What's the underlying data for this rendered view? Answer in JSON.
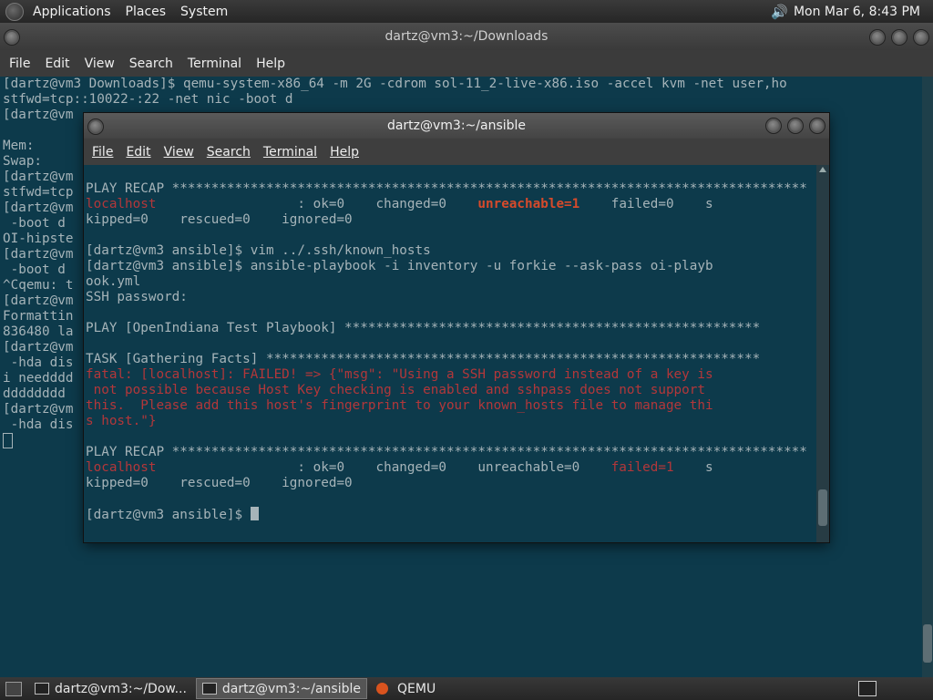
{
  "top_panel": {
    "menus": [
      "Applications",
      "Places",
      "System"
    ],
    "clock": "Mon Mar  6,  8:43 PM"
  },
  "back_window": {
    "title": "dartz@vm3:~/Downloads",
    "menu": [
      "File",
      "Edit",
      "View",
      "Search",
      "Terminal",
      "Help"
    ],
    "lines": [
      "[dartz@vm3 Downloads]$ qemu-system-x86_64 -m 2G -cdrom sol-11_2-live-x86.iso -accel kvm -net user,ho",
      "stfwd=tcp::10022-:22 -net nic -boot d",
      "[dartz@vm",
      "",
      "Mem:",
      "Swap:",
      "[dartz@vm                                                                                 t user,ho",
      "stfwd=tcp",
      "[dartz@vm                                                                                 -net nic",
      " -boot d",
      "OI-hipste",
      "[dartz@vm                                                                                 -net nic",
      " -boot d",
      "^Cqemu: t",
      "[dartz@vm",
      "Formattin                                                                                ize=21474",
      "836480 la",
      "[dartz@vm                                                                                 -net nic",
      " -hda dis",
      "i needddd                                                                               dddddddd",
      "dddddddd",
      "[dartz@vm                                                                                 -net nic",
      " -hda dis"
    ]
  },
  "front_window": {
    "title": "dartz@vm3:~/ansible",
    "menu": [
      "File",
      "Edit",
      "View",
      "Search",
      "Terminal",
      "Help"
    ],
    "lines": [
      {
        "segs": [
          {
            "t": "PLAY RECAP *********************************************************************************"
          }
        ]
      },
      {
        "segs": [
          {
            "t": "localhost",
            "c": "red"
          },
          {
            "t": "                  : ok=0    changed=0    "
          },
          {
            "t": "unreachable=1",
            "c": "bold-red"
          },
          {
            "t": "    failed=0    s"
          }
        ]
      },
      {
        "segs": [
          {
            "t": "kipped=0    rescued=0    ignored=0"
          }
        ]
      },
      {
        "segs": [
          {
            "t": ""
          }
        ]
      },
      {
        "segs": [
          {
            "t": "[dartz@vm3 ansible]$ vim ../.ssh/known_hosts"
          }
        ]
      },
      {
        "segs": [
          {
            "t": "[dartz@vm3 ansible]$ ansible-playbook -i inventory -u forkie --ask-pass oi-playb"
          }
        ]
      },
      {
        "segs": [
          {
            "t": "ook.yml"
          }
        ]
      },
      {
        "segs": [
          {
            "t": "SSH password:"
          }
        ]
      },
      {
        "segs": [
          {
            "t": ""
          }
        ]
      },
      {
        "segs": [
          {
            "t": "PLAY [OpenIndiana Test Playbook] *****************************************************"
          }
        ]
      },
      {
        "segs": [
          {
            "t": ""
          }
        ]
      },
      {
        "segs": [
          {
            "t": "TASK [Gathering Facts] ***************************************************************"
          }
        ]
      },
      {
        "segs": [
          {
            "t": "fatal: [localhost]: FAILED! => {\"msg\": \"Using a SSH password instead of a key is",
            "c": "red"
          }
        ]
      },
      {
        "segs": [
          {
            "t": " not possible because Host Key checking is enabled and sshpass does not support",
            "c": "red"
          }
        ]
      },
      {
        "segs": [
          {
            "t": "this.  Please add this host's fingerprint to your known_hosts file to manage thi",
            "c": "red"
          }
        ]
      },
      {
        "segs": [
          {
            "t": "s host.\"}",
            "c": "red"
          }
        ]
      },
      {
        "segs": [
          {
            "t": ""
          }
        ]
      },
      {
        "segs": [
          {
            "t": "PLAY RECAP *********************************************************************************"
          }
        ]
      },
      {
        "segs": [
          {
            "t": "localhost",
            "c": "red"
          },
          {
            "t": "                  : ok=0    changed=0    unreachable=0    "
          },
          {
            "t": "failed=1",
            "c": "red"
          },
          {
            "t": "    s"
          }
        ]
      },
      {
        "segs": [
          {
            "t": "kipped=0    rescued=0    ignored=0"
          }
        ]
      },
      {
        "segs": [
          {
            "t": ""
          }
        ]
      },
      {
        "segs": [
          {
            "t": "[dartz@vm3 ansible]$ "
          }
        ],
        "cursor": true
      }
    ]
  },
  "taskbar": {
    "tasks": [
      "dartz@vm3:~/Dow...",
      "dartz@vm3:~/ansible",
      "QEMU"
    ]
  },
  "colors": {
    "terminal_bg": "#0d3a4b",
    "terminal_fg": "#a6b4b9",
    "error_red": "#b3373a",
    "highlight_orange": "#d64a2b"
  }
}
